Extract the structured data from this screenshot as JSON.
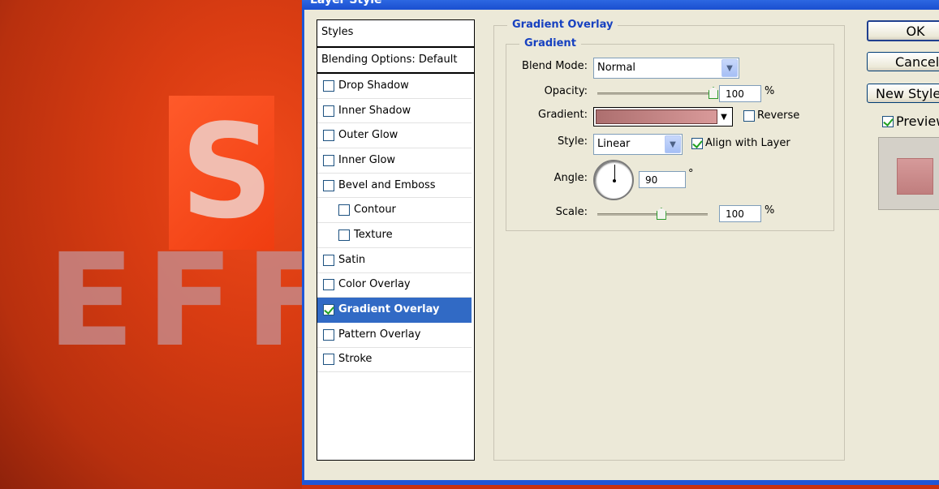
{
  "canvas": {
    "letter": "S",
    "word": "EFF"
  },
  "dialog": {
    "title": "Layer Style",
    "styles_header": "Styles",
    "blending_options": "Blending Options: Default",
    "style_items": [
      {
        "label": "Drop Shadow",
        "checked": false
      },
      {
        "label": "Inner Shadow",
        "checked": false
      },
      {
        "label": "Outer Glow",
        "checked": false
      },
      {
        "label": "Inner Glow",
        "checked": false
      },
      {
        "label": "Bevel and Emboss",
        "checked": false
      },
      {
        "label": "Contour",
        "checked": false
      },
      {
        "label": "Texture",
        "checked": false
      },
      {
        "label": "Satin",
        "checked": false
      },
      {
        "label": "Color Overlay",
        "checked": false
      },
      {
        "label": "Gradient Overlay",
        "checked": true,
        "selected": true
      },
      {
        "label": "Pattern Overlay",
        "checked": false
      },
      {
        "label": "Stroke",
        "checked": false
      }
    ],
    "gradient_overlay": {
      "section_title": "Gradient Overlay",
      "subsection_title": "Gradient",
      "blend_mode_label": "Blend Mode:",
      "blend_mode_value": "Normal",
      "opacity_label": "Opacity:",
      "opacity_value": "100",
      "opacity_level": 1.0,
      "opacity_unit": "%",
      "gradient_label": "Gradient:",
      "gradient_colors": [
        "#ad6f6f",
        "#d99a9a"
      ],
      "reverse_label": "Reverse",
      "reverse_checked": false,
      "style_label": "Style:",
      "style_value": "Linear",
      "align_label": "Align with Layer",
      "align_checked": true,
      "angle_label": "Angle:",
      "angle_value": "90",
      "angle_unit": "°",
      "scale_label": "Scale:",
      "scale_value": "100",
      "scale_level": 0.58,
      "scale_unit": "%"
    },
    "buttons": {
      "ok": "OK",
      "cancel": "Cancel",
      "new_style": "New Style",
      "preview": "Preview",
      "preview_checked": true
    }
  }
}
